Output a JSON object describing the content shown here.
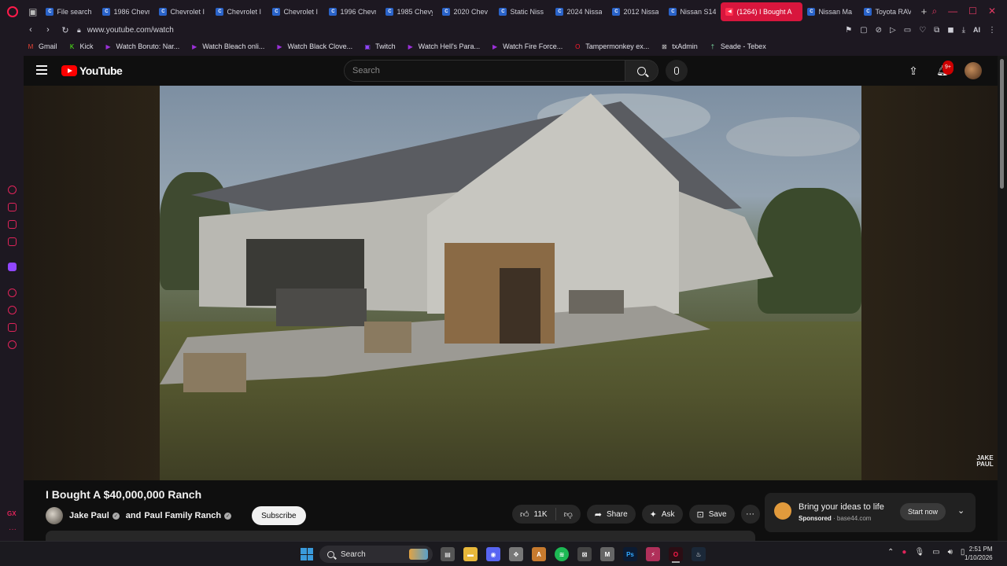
{
  "browser": {
    "tabs": [
      {
        "label": "File search",
        "active": false
      },
      {
        "label": "1986 Chevr",
        "active": false
      },
      {
        "label": "Chevrolet I",
        "active": false
      },
      {
        "label": "Chevrolet I",
        "active": false
      },
      {
        "label": "Chevrolet I",
        "active": false
      },
      {
        "label": "1996 Chevr",
        "active": false
      },
      {
        "label": "1985 Chevy",
        "active": false
      },
      {
        "label": "2020 Chev",
        "active": false
      },
      {
        "label": "Static Niss",
        "active": false
      },
      {
        "label": "2024 Nissa",
        "active": false
      },
      {
        "label": "2012 Nissa",
        "active": false
      },
      {
        "label": "Nissan S14",
        "active": false
      },
      {
        "label": "(1264) I Bought A",
        "active": true
      },
      {
        "label": "Nissan Ma",
        "active": false
      },
      {
        "label": "Toyota RAV",
        "active": false
      }
    ],
    "url": "www.youtube.com/watch",
    "ai_label": "AI",
    "bookmarks": [
      {
        "label": "Gmail",
        "icon": "gmail-icon",
        "color": "#ea4335"
      },
      {
        "label": "Kick",
        "icon": "kick-icon",
        "color": "#53fc18"
      },
      {
        "label": "Watch Boruto: Nar...",
        "icon": "crunchyroll-icon",
        "color": "#9b30d9"
      },
      {
        "label": "Watch Bleach onli...",
        "icon": "crunchyroll-icon",
        "color": "#9b30d9"
      },
      {
        "label": "Watch Black Clove...",
        "icon": "crunchyroll-icon",
        "color": "#9b30d9"
      },
      {
        "label": "Twitch",
        "icon": "twitch-icon",
        "color": "#9146ff"
      },
      {
        "label": "Watch Hell's Para...",
        "icon": "crunchyroll-icon",
        "color": "#9b30d9"
      },
      {
        "label": "Watch Fire Force...",
        "icon": "crunchyroll-icon",
        "color": "#9b30d9"
      },
      {
        "label": "Tampermonkey ex...",
        "icon": "opera-icon",
        "color": "#ff1b2d"
      },
      {
        "label": "txAdmin",
        "icon": "txadmin-icon",
        "color": "#cccccc"
      },
      {
        "label": "Seade - Tebex",
        "icon": "tebex-icon",
        "color": "#7ad6a0"
      }
    ]
  },
  "youtube": {
    "logo_text": "YouTube",
    "search_placeholder": "Search",
    "notifications_badge": "9+",
    "video_watermark": "JAKE PAUL",
    "video": {
      "title": "I Bought A $40,000,000 Ranch",
      "channel": "Jake Paul",
      "collab_prefix": "and",
      "collab_channel": "Paul Family Ranch",
      "subscribe_label": "Subscribe",
      "like_count": "11K",
      "share_label": "Share",
      "ask_label": "Ask",
      "save_label": "Save"
    },
    "ad": {
      "headline": "Bring your ideas to life",
      "sponsored": "Sponsored",
      "domain": "base44.com",
      "cta": "Start now"
    }
  },
  "taskbar": {
    "search_label": "Search",
    "time": "2:51 PM",
    "date": "1/10/2026"
  },
  "colors": {
    "accent": "#d8163d",
    "youtube_red": "#ff0000"
  }
}
